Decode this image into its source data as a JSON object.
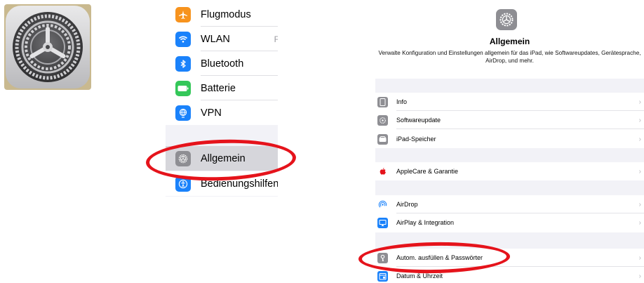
{
  "left_settings": {
    "items": [
      {
        "label": "Flugmodus",
        "icon": "airplane-icon",
        "color": "#f7931e"
      },
      {
        "label": "WLAN",
        "trailing": "F",
        "icon": "wifi-icon",
        "color": "#1a82fb"
      },
      {
        "label": "Bluetooth",
        "icon": "bluetooth-icon",
        "color": "#1a82fb"
      },
      {
        "label": "Batterie",
        "icon": "battery-icon",
        "color": "#34c759"
      },
      {
        "label": "VPN",
        "icon": "vpn-globe-icon",
        "color": "#1a82fb"
      },
      {
        "label": "Allgemein",
        "icon": "gear-icon",
        "color": "#8e8e93",
        "selected": true
      },
      {
        "label": "Bedienungshilfen",
        "icon": "accessibility-icon",
        "color": "#1a82fb"
      }
    ]
  },
  "general_page": {
    "title": "Allgemein",
    "description": "Verwalte Konfiguration und Einstellungen allgemein für das iPad, wie Softwareupdates, Gerätesprache, AirDrop, und mehr.",
    "groups": [
      [
        {
          "label": "Info",
          "icon": "ipad-icon",
          "color": "#8e8e93"
        },
        {
          "label": "Softwareupdate",
          "icon": "gear-icon",
          "color": "#8e8e93"
        },
        {
          "label": "iPad-Speicher",
          "icon": "storage-icon",
          "color": "#8e8e93"
        }
      ],
      [
        {
          "label": "AppleCare & Garantie",
          "icon": "apple-icon",
          "color": "#e5131b"
        }
      ],
      [
        {
          "label": "AirDrop",
          "icon": "airdrop-icon",
          "color": "#1a82fb"
        },
        {
          "label": "AirPlay & Integration",
          "icon": "airplay-icon",
          "color": "#1a82fb"
        }
      ],
      [
        {
          "label": "Autom. ausfüllen & Passwörter",
          "icon": "key-icon",
          "color": "#8e8e93"
        },
        {
          "label": "Datum & Uhrzeit",
          "icon": "calendar-icon",
          "color": "#1a82fb"
        }
      ]
    ]
  },
  "highlight_color": "#e5131b"
}
